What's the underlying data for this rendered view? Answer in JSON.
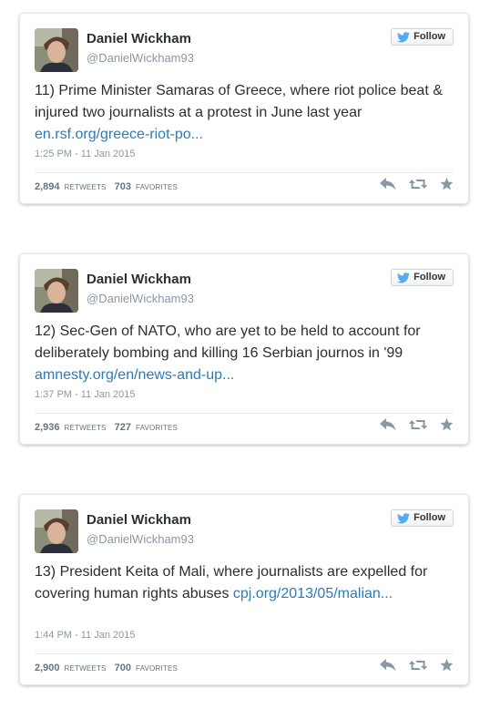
{
  "tweets": [
    {
      "name": "Daniel Wickham",
      "handle": "@DanielWickham93",
      "follow_label": "Follow",
      "text": "11) Prime Minister Samaras of Greece, where riot police beat & injured two journalists at a protest in June last year ",
      "link": "en.rsf.org/greece-riot-po...",
      "time": "1:25 PM - 11 Jan 2015",
      "retweets": "2,894",
      "retweets_label": "RETWEETS",
      "favorites": "703",
      "favorites_label": "FAVORITES"
    },
    {
      "name": "Daniel Wickham",
      "handle": "@DanielWickham93",
      "follow_label": "Follow",
      "text": "12) Sec-Gen of NATO, who are yet to be held to account for deliberately bombing and killing 16 Serbian journos in '99 ",
      "link": "amnesty.org/en/news-and-up...",
      "time": "1:37 PM - 11 Jan 2015",
      "retweets": "2,936",
      "retweets_label": "RETWEETS",
      "favorites": "727",
      "favorites_label": "FAVORITES"
    },
    {
      "name": "Daniel Wickham",
      "handle": "@DanielWickham93",
      "follow_label": "Follow",
      "text": "13) President Keita of Mali, where journalists are expelled for covering human rights abuses ",
      "link": "cpj.org/2013/05/malian...",
      "time": "1:44 PM - 11 Jan 2015",
      "retweets": "2,900",
      "retweets_label": "RETWEETS",
      "favorites": "700",
      "favorites_label": "FAVORITES"
    }
  ],
  "colors": {
    "link": "#2b7bb9",
    "twitter_bird": "#55acee",
    "muted": "#8899a6",
    "icon": "#8899a6"
  },
  "icons": [
    "twitter-bird-icon",
    "reply-icon",
    "retweet-icon",
    "favorite-star-icon"
  ]
}
